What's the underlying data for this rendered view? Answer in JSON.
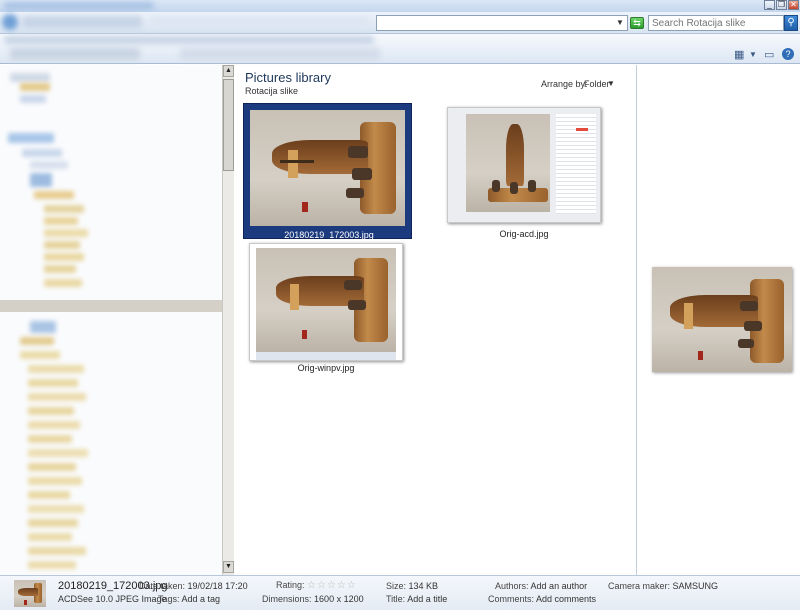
{
  "window": {
    "minimize_glyph": "_",
    "maximize_glyph": "❐",
    "close_glyph": "✕"
  },
  "address_bar": {
    "dropdown_glyph": "▼",
    "refresh_glyph": "⇆"
  },
  "search": {
    "placeholder": "Search Rotacija slike",
    "icon": "search-icon",
    "icon_glyph": "⚲"
  },
  "toolbar": {
    "view_icon": "change-view-icon",
    "view_glyph": "▦",
    "view_dropdown_glyph": "▼",
    "preview_pane_icon": "preview-pane-icon",
    "preview_pane_glyph": "▭",
    "help_icon": "help-icon",
    "help_glyph": "?"
  },
  "nav_scrollbar": {
    "up_glyph": "▲",
    "down_glyph": "▼"
  },
  "library": {
    "title": "Pictures library",
    "subtitle": "Rotacija slike",
    "arrange_label": "Arrange by:",
    "arrange_value": "Folder",
    "arrange_dropdown_glyph": "▼"
  },
  "files": [
    {
      "name": "20180219_172003.jpg",
      "selected": true
    },
    {
      "name": "Orig-acd.jpg",
      "selected": false
    },
    {
      "name": "Orig-winpv.jpg",
      "selected": false
    }
  ],
  "details": {
    "filename": "20180219_172003.jpg",
    "filetype": "ACDSee 10.0 JPEG Image",
    "date_taken_label": "Date taken:",
    "date_taken": "19/02/18 17:20",
    "tags_label": "Tags:",
    "tags": "Add a tag",
    "rating_label": "Rating:",
    "rating_stars": "☆☆☆☆☆",
    "rating_value": 0,
    "dimensions_label": "Dimensions:",
    "dimensions": "1600 x 1200",
    "size_label": "Size:",
    "size": "134 KB",
    "title_label": "Title:",
    "title": "Add a title",
    "authors_label": "Authors:",
    "authors": "Add an author",
    "comments_label": "Comments:",
    "comments": "Add comments",
    "camera_maker_label": "Camera maker:",
    "camera_maker": "SAMSUNG"
  },
  "colors": {
    "selection": "#1c3a7e",
    "title_text": "#1e395b",
    "nav_selected": "#d4d0c8"
  }
}
